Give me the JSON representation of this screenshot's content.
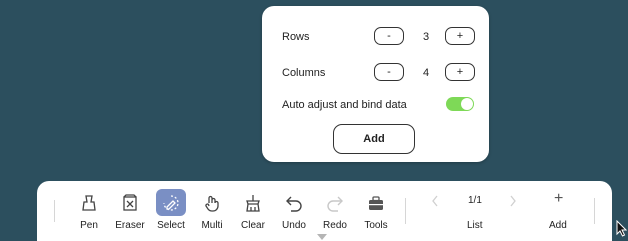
{
  "popup": {
    "rows_label": "Rows",
    "rows_value": "3",
    "columns_label": "Columns",
    "columns_value": "4",
    "decrement": "-",
    "increment": "+",
    "auto_adjust_label": "Auto adjust and bind data",
    "auto_adjust_on": true,
    "add_label": "Add"
  },
  "toolbar": {
    "tools": [
      {
        "label": "Pen",
        "icon": "pen-icon"
      },
      {
        "label": "Eraser",
        "icon": "eraser-icon"
      },
      {
        "label": "Select",
        "icon": "select-icon",
        "active": true
      },
      {
        "label": "Multi",
        "icon": "multi-touch-icon"
      },
      {
        "label": "Clear",
        "icon": "clear-icon"
      },
      {
        "label": "Undo",
        "icon": "undo-icon"
      },
      {
        "label": "Redo",
        "icon": "redo-icon",
        "disabled": true
      },
      {
        "label": "Tools",
        "icon": "toolbox-icon"
      }
    ],
    "page_indicator": "1/1",
    "list_label": "List",
    "add_glyph": "+",
    "add_label": "Add"
  },
  "colors": {
    "background": "#2c4f5e",
    "active_tool": "#7a8fc4",
    "toggle_on": "#7ed957"
  }
}
